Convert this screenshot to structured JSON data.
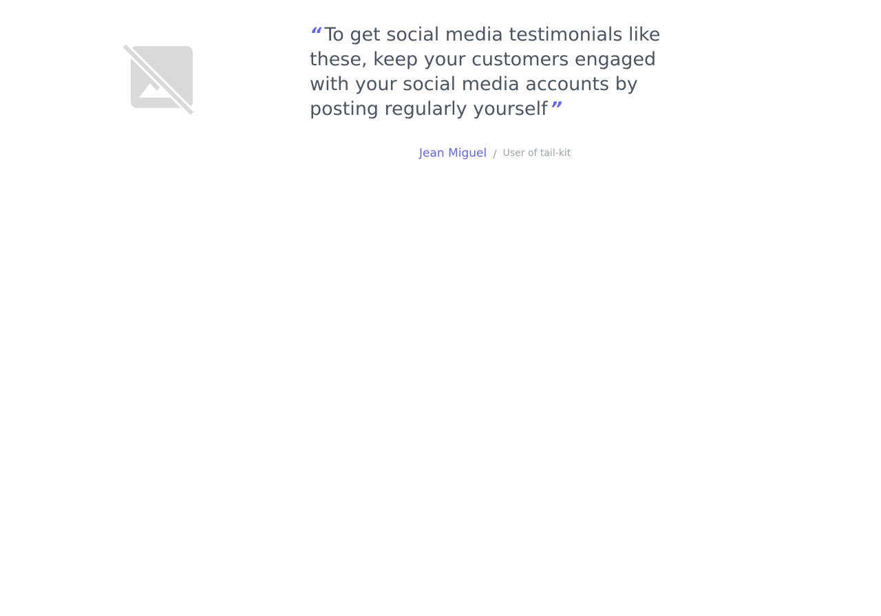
{
  "testimonial": {
    "avatar_icon": "broken-image-icon",
    "quote_open": "“",
    "quote_text": "To get social media testimonials like these, keep your customers engaged with your social media accounts by posting regularly yourself",
    "quote_close": "”",
    "author_name": "Jean Miguel",
    "separator": "/",
    "author_role": "User of tail-kit"
  },
  "colors": {
    "accent": "#6366f1",
    "quote_text": "#4b5563",
    "muted": "#9ca3af",
    "placeholder_icon": "#d9d9d9"
  }
}
